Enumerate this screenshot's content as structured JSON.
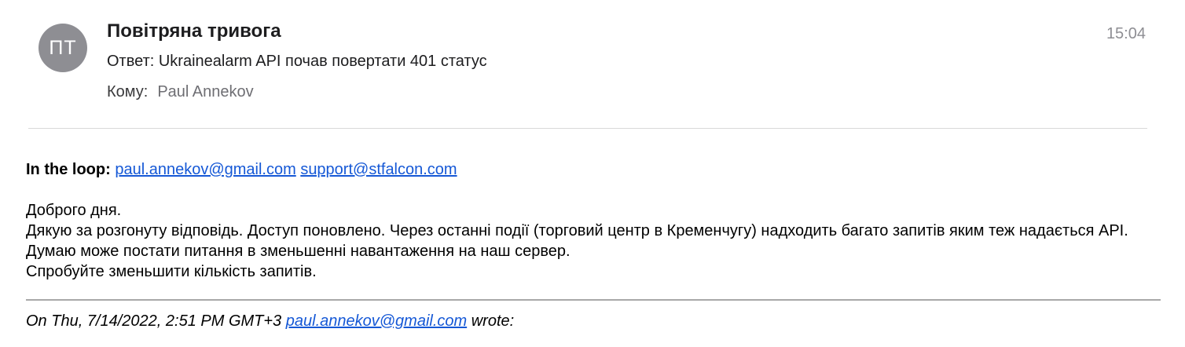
{
  "header": {
    "avatar_initials": "ПТ",
    "sender": "Повітряна тривога",
    "time": "15:04",
    "subject": "Ответ: Ukrainealarm API почав повертати 401 статус",
    "to_label": "Кому:",
    "to_value": "Paul Annekov"
  },
  "body": {
    "loop_label": "In the loop:",
    "loop_emails": [
      "paul.annekov@gmail.com",
      "support@stfalcon.com"
    ],
    "greeting": "Доброго дня.",
    "paragraph": "Дякую за розгонуту відповідь. Доступ поновлено. Через останні події (торговий центр в Кременчугу) надходить багато запитів яким теж надається API. Думаю може постати питання в зменьшенні навантаження на наш сервер.",
    "request": "Спробуйте зменьшити кількість запитів."
  },
  "quote": {
    "prefix": "On Thu, 7/14/2022, 2:51 PM GMT+3",
    "email": "paul.annekov@gmail.com",
    "suffix": "wrote:"
  },
  "colors": {
    "link": "#1558d6",
    "avatar_bg": "#8e8e93"
  }
}
